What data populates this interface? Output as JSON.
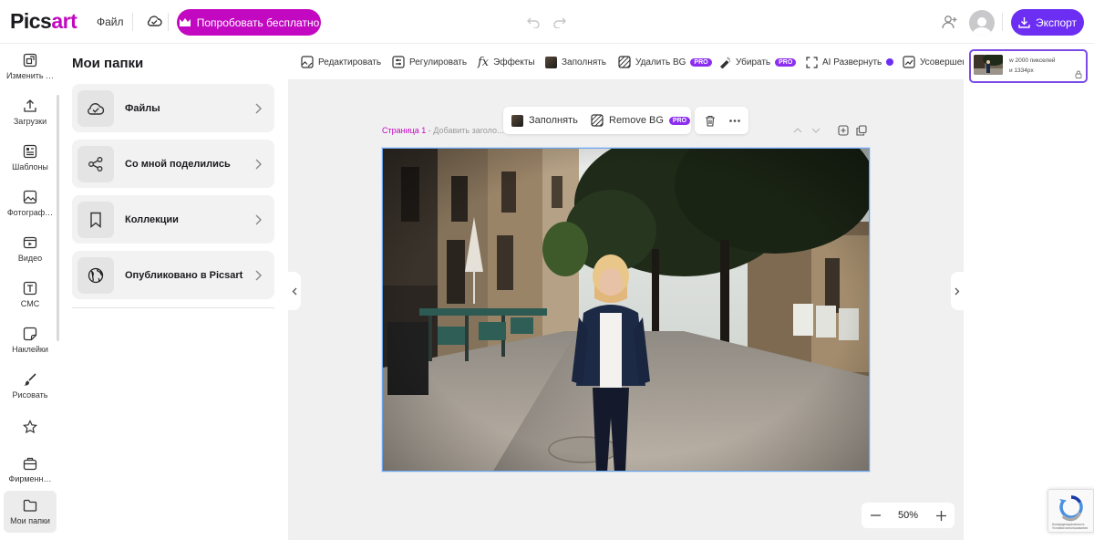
{
  "app": {
    "logo_main": "Pics",
    "logo_accent": "art"
  },
  "header": {
    "file_menu": "Файл",
    "try_free": "Попробовать бесплатно",
    "export": "Экспорт",
    "accent_color": "#c209c1",
    "export_color": "#6c2ef2"
  },
  "rail": {
    "items": [
      {
        "label": "Изменить …",
        "icon": "resize-icon"
      },
      {
        "label": "Загрузки",
        "icon": "upload-icon"
      },
      {
        "label": "Шаблоны",
        "icon": "templates-icon"
      },
      {
        "label": "Фотограф…",
        "icon": "photo-icon"
      },
      {
        "label": "Видео",
        "icon": "video-icon"
      },
      {
        "label": "СМС",
        "icon": "text-icon"
      },
      {
        "label": "Наклейки",
        "icon": "sticker-icon"
      },
      {
        "label": "Рисовать",
        "icon": "brush-icon"
      },
      {
        "label": "",
        "icon": "star-icon"
      },
      {
        "label": "Фирменн…",
        "icon": "brand-kit-icon"
      },
      {
        "label": "Мои папки",
        "icon": "folder-icon"
      }
    ]
  },
  "panel": {
    "title": "Мои папки",
    "folders": [
      {
        "label": "Файлы",
        "icon": "cloud-check-icon"
      },
      {
        "label": "Со мной поделились",
        "icon": "share-icon"
      },
      {
        "label": "Коллекции",
        "icon": "bookmark-icon"
      },
      {
        "label": "Опубликовано в Picsart",
        "icon": "globe-icon"
      }
    ]
  },
  "toolbar": {
    "tools": [
      {
        "label": "Редактировать",
        "icon": "edit-image-icon"
      },
      {
        "label": "Регулировать",
        "icon": "adjust-icon"
      },
      {
        "label": "Эффекты",
        "icon": "fx-icon"
      },
      {
        "label": "Заполнять",
        "icon": "fill-icon"
      },
      {
        "label": "Удалить BG",
        "icon": "remove-bg-icon",
        "badge": "PRO"
      },
      {
        "label": "Убирать",
        "icon": "eraser-icon",
        "badge": "PRO"
      },
      {
        "label": "AI Развернуть",
        "icon": "expand-icon"
      },
      {
        "label": "Усовершен",
        "icon": "enhance-icon"
      }
    ]
  },
  "float_bar": {
    "fill": "Заполнять",
    "remove_bg": "Remove BG",
    "badge": "PRO"
  },
  "page": {
    "number": "Страница 1",
    "sep": " - ",
    "title_placeholder": "Добавить заголо..."
  },
  "zoom": {
    "value": "50%"
  },
  "thumbnail": {
    "line1": "w  2000 пикселей",
    "line2": "и  1334px"
  },
  "recaptcha": {
    "text1": "Конфиденциальность",
    "text2": "Условия использования"
  }
}
